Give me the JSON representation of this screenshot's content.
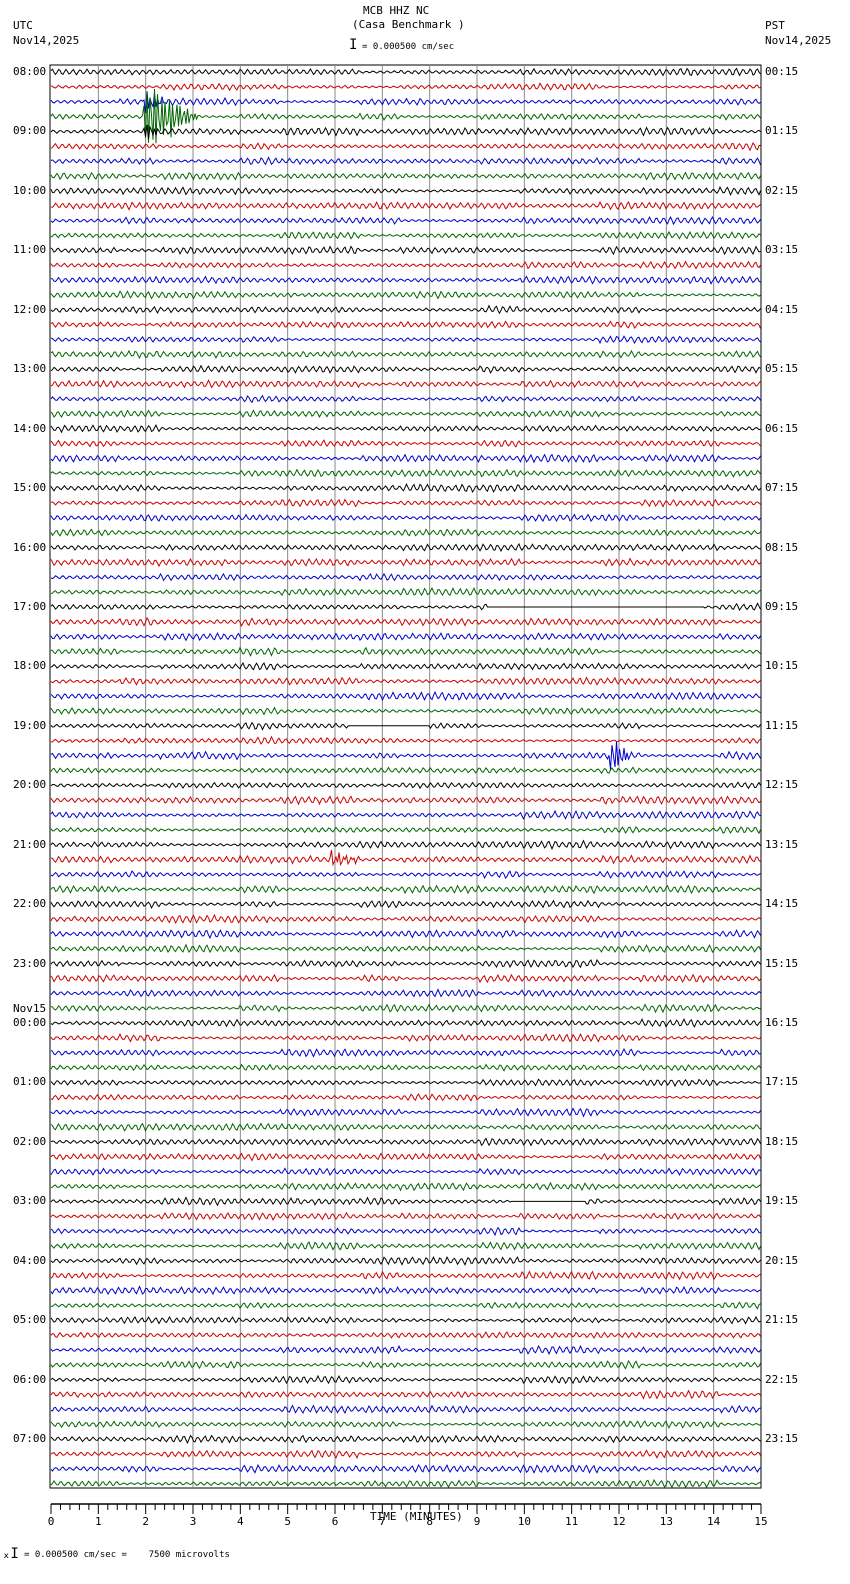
{
  "header": {
    "station": "MCB HHZ NC",
    "location": "(Casa Benchmark )",
    "scale_text": "= 0.000500 cm/sec",
    "left_tz": "UTC",
    "left_date": "Nov14,2025",
    "right_tz": "PST",
    "right_date": "Nov14,2025"
  },
  "footer": {
    "scale_text": "= 0.000500 cm/sec =    7500 microvolts"
  },
  "chart_data": {
    "type": "line",
    "title": "MCB HHZ NC (Casa Benchmark )",
    "xlabel": "TIME (MINUTES)",
    "xlim": [
      0,
      15
    ],
    "x_ticks": [
      "0",
      "1",
      "2",
      "3",
      "4",
      "5",
      "6",
      "7",
      "8",
      "9",
      "10",
      "11",
      "12",
      "13",
      "14",
      "15"
    ],
    "traces_per_hour": 4,
    "trace_colors": [
      "#000000",
      "#cc0000",
      "#0000cc",
      "#006600"
    ],
    "left_labels": [
      "08:00",
      "09:00",
      "10:00",
      "11:00",
      "12:00",
      "13:00",
      "14:00",
      "15:00",
      "16:00",
      "17:00",
      "18:00",
      "19:00",
      "20:00",
      "21:00",
      "22:00",
      "23:00",
      "00:00",
      "01:00",
      "02:00",
      "03:00",
      "04:00",
      "05:00",
      "06:00",
      "07:00"
    ],
    "date_change_label": "Nov15",
    "date_change_index": 16,
    "right_labels": [
      "00:15",
      "01:15",
      "02:15",
      "03:15",
      "04:15",
      "05:15",
      "06:15",
      "07:15",
      "08:15",
      "09:15",
      "10:15",
      "11:15",
      "12:15",
      "13:15",
      "14:15",
      "15:15",
      "16:15",
      "17:15",
      "18:15",
      "19:15",
      "20:15",
      "21:15",
      "22:15",
      "23:15"
    ],
    "events": [
      {
        "trace": 3,
        "minute": 1.95,
        "amplitude": 5.0,
        "duration": 1.2
      },
      {
        "trace": 2,
        "minute": 1.95,
        "amplitude": 2.0,
        "duration": 0.5
      },
      {
        "trace": 4,
        "minute": 1.95,
        "amplitude": 1.5,
        "duration": 0.4
      },
      {
        "trace": 46,
        "minute": 11.8,
        "amplitude": 3.0,
        "duration": 0.5
      },
      {
        "trace": 53,
        "minute": 5.9,
        "amplitude": 1.0,
        "duration": 0.7
      }
    ],
    "gaps": [
      {
        "trace": 36,
        "from": 9.2,
        "to": 13.8
      },
      {
        "trace": 44,
        "from": 6.3,
        "to": 8.0
      },
      {
        "trace": 76,
        "from": 9.7,
        "to": 11.3
      }
    ]
  }
}
